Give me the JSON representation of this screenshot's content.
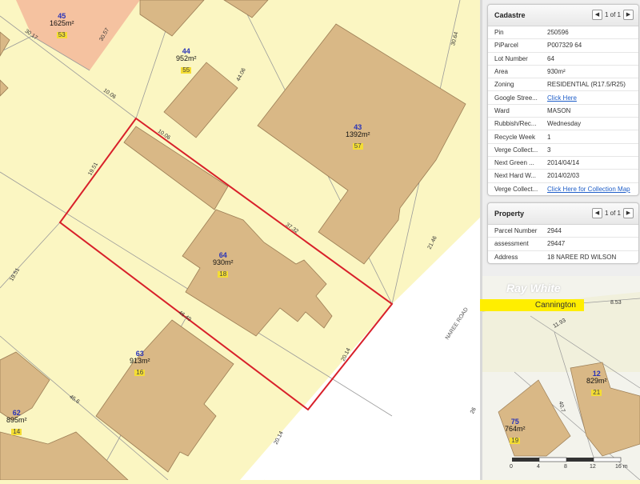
{
  "map": {
    "lots": [
      {
        "number": "45",
        "area": "1625m²",
        "badge": "53"
      },
      {
        "number": "44",
        "area": "952m²",
        "badge": "55"
      },
      {
        "number": "43",
        "area": "1392m²",
        "badge": "57"
      },
      {
        "number": "64",
        "area": "930m²",
        "badge": "18"
      },
      {
        "number": "63",
        "area": "913m²",
        "badge": "16"
      },
      {
        "number": "62",
        "area": "895m²",
        "badge": "14"
      }
    ],
    "dimensions": [
      "30.17",
      "30.57",
      "10.06",
      "44.06",
      "30.64",
      "10.06",
      "19.51",
      "37.32",
      "21.46",
      "19.51",
      "46.49",
      "20.14",
      "45.6",
      "20.14",
      "26"
    ],
    "street": "NAREE ROAD"
  },
  "cadastre": {
    "title": "Cadastre",
    "pager": "1 of 1",
    "rows": [
      {
        "key": "Pin",
        "value": "250596"
      },
      {
        "key": "PiParcel",
        "value": "P007329 64"
      },
      {
        "key": "Lot Number",
        "value": "64"
      },
      {
        "key": "Area",
        "value": "930m²"
      },
      {
        "key": "Zoning",
        "value": "RESIDENTIAL (R17.5/R25)"
      },
      {
        "key": "Google Stree...",
        "value": "Click Here"
      },
      {
        "key": "Ward",
        "value": "MASON"
      },
      {
        "key": "Rubbish/Rec...",
        "value": "Wednesday"
      },
      {
        "key": "Recycle Week",
        "value": "1"
      },
      {
        "key": "Verge Collect...",
        "value": "3"
      },
      {
        "key": "Next Green ...",
        "value": "2014/04/14"
      },
      {
        "key": "Next Hard W...",
        "value": "2014/02/03"
      },
      {
        "key": "Verge Collect...",
        "value": "Click Here for Collection Map"
      }
    ]
  },
  "property": {
    "title": "Property",
    "pager": "1 of 1",
    "rows": [
      {
        "key": "Parcel Number",
        "value": "2944"
      },
      {
        "key": "assessment",
        "value": "29447"
      },
      {
        "key": "Address",
        "value": "18 NAREE RD WILSON"
      }
    ]
  },
  "minimap": {
    "brand": "Ray White",
    "banner": "Cannington",
    "dims": [
      "8.53",
      "11.93",
      "40.7"
    ],
    "lots": [
      {
        "number": "12",
        "area": "829m²",
        "badge": "21"
      },
      {
        "number": "75",
        "area": "764m²",
        "badge": "19"
      }
    ],
    "scale": [
      "0",
      "4",
      "8",
      "12",
      "16 m"
    ]
  },
  "colors": {
    "parcel_fill": "#fbf6c2",
    "building_fill": "#d9b886",
    "highlight_lot": "#d8202a",
    "road": "#ffffff",
    "lot45_fill": "#f5c2a0"
  }
}
